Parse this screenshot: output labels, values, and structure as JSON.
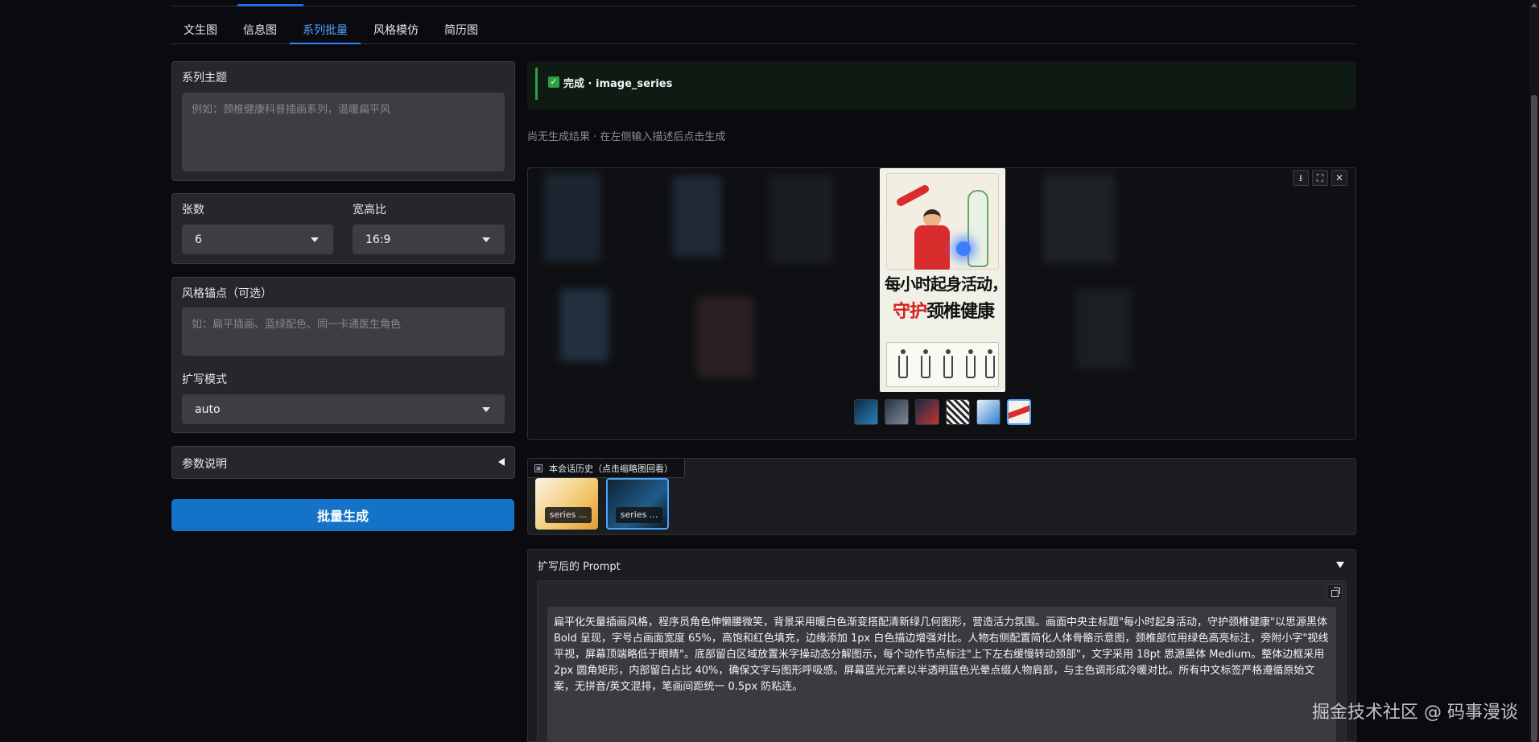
{
  "tabs": [
    {
      "label": "文生图",
      "active": false
    },
    {
      "label": "信息图",
      "active": false
    },
    {
      "label": "系列批量",
      "active": true
    },
    {
      "label": "风格模仿",
      "active": false
    },
    {
      "label": "简历图",
      "active": false
    }
  ],
  "series_theme": {
    "label": "系列主题",
    "placeholder": "例如：颈椎健康科普插画系列，温暖扁平风",
    "value": ""
  },
  "count": {
    "label": "张数",
    "value": "6"
  },
  "aspect_ratio": {
    "label": "宽高比",
    "value": "16:9"
  },
  "style_anchor": {
    "label": "风格锚点（可选）",
    "placeholder": "如：扁平插画、蓝绿配色、同一卡通医生角色",
    "value": ""
  },
  "expand_mode": {
    "label": "扩写模式",
    "value": "auto"
  },
  "params": {
    "label": "参数说明"
  },
  "generate_button": "批量生成",
  "status": {
    "text": "完成 · image_series",
    "check": "✓"
  },
  "hint": "尚无生成结果 · 在左侧输入描述后点击生成",
  "gallery": {
    "tools": [
      "⭳",
      "⛶",
      "✕"
    ],
    "poster": {
      "title_line1": "每小时起身活动，",
      "title_line2_red": "守护",
      "title_line2_rest": "颈椎健康"
    },
    "thumb_count": 6,
    "active_thumb": 5
  },
  "history": {
    "label": "本会话历史（点击缩略图回看）",
    "items": [
      {
        "caption": "series ..."
      },
      {
        "caption": "series ..."
      }
    ]
  },
  "prompt": {
    "title": "扩写后的 Prompt",
    "text": "扁平化矢量插画风格，程序员角色伸懒腰微笑，背景采用暖白色渐变搭配清新绿几何图形，营造活力氛围。画面中央主标题\"每小时起身活动，守护颈椎健康\"以思源黑体 Bold 呈现，字号占画面宽度 65%，高饱和红色填充，边缘添加 1px 白色描边增强对比。人物右侧配置简化人体骨骼示意图，颈椎部位用绿色高亮标注，旁附小字\"视线平视，屏幕顶端略低于眼睛\"。底部留白区域放置米字操动态分解图示，每个动作节点标注\"上下左右缓慢转动颈部\"，文字采用 18pt 思源黑体 Medium。整体边框采用 2px 圆角矩形，内部留白占比 40%，确保文字与图形呼吸感。屏幕蓝光元素以半透明蓝色光晕点缀人物肩部，与主色调形成冷暖对比。所有中文标签严格遵循原始文案，无拼音/英文混排，笔画间距统一 0.5px 防粘连。"
  },
  "watermark": "掘金技术社区 @ 码事漫谈",
  "colors": {
    "accent": "#1473c8",
    "tab_active": "#4ea3ff",
    "success": "#2ea043"
  }
}
